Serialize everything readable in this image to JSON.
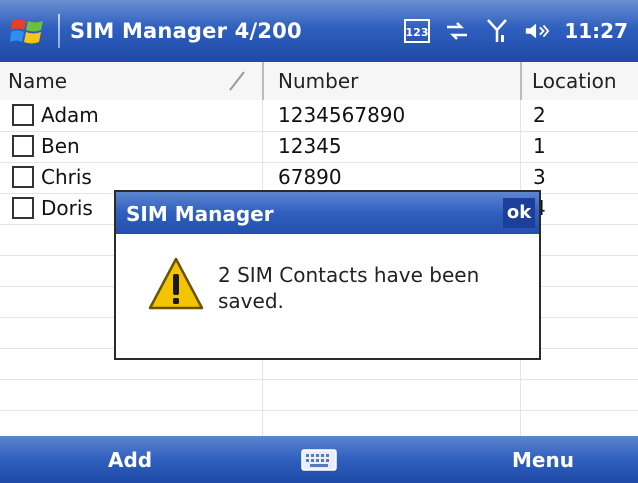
{
  "title_bar": {
    "app_title": "SIM Manager 4/200",
    "input_mode_label": "123",
    "time": "11:27"
  },
  "columns": {
    "name": "Name",
    "number": "Number",
    "location": "Location"
  },
  "contacts": [
    {
      "name": "Adam",
      "number": "1234567890",
      "location": "2"
    },
    {
      "name": "Ben",
      "number": "12345",
      "location": "1"
    },
    {
      "name": "Chris",
      "number": "67890",
      "location": "3"
    },
    {
      "name": "Doris",
      "number": "",
      "location": "4"
    }
  ],
  "dialog": {
    "title": "SIM Manager",
    "ok_label": "ok",
    "message": "2 SIM Contacts have been saved."
  },
  "softkeys": {
    "left": "Add",
    "right": "Menu"
  },
  "colors": {
    "accent_blue": "#2f5fbf",
    "warning_yellow": "#f5c400"
  }
}
